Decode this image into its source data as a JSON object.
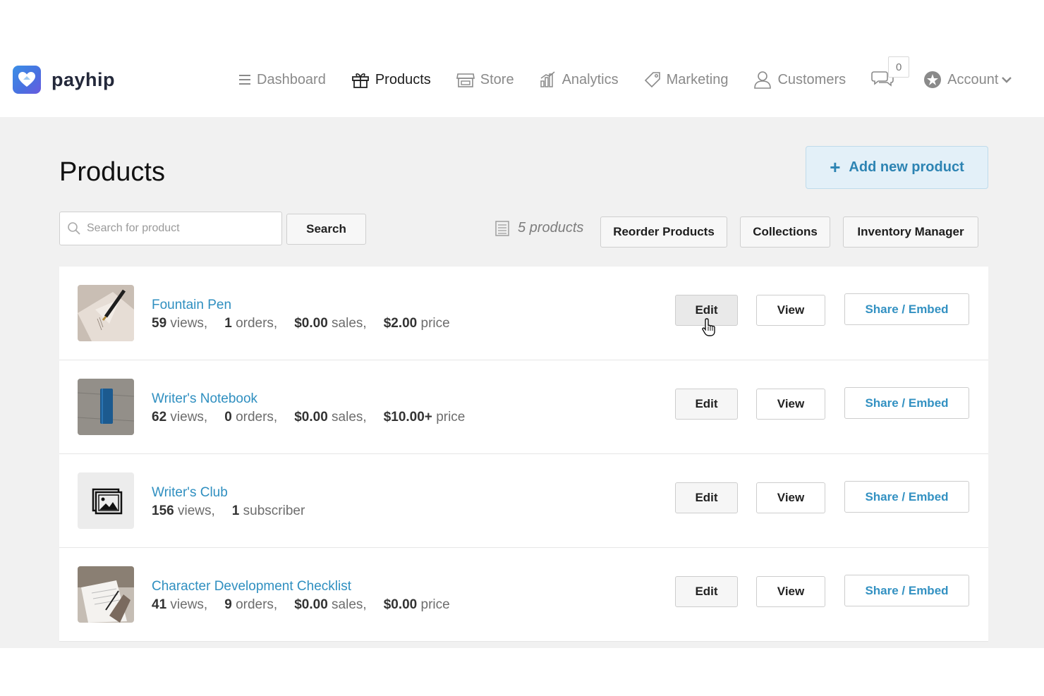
{
  "brand": {
    "name": "payhip"
  },
  "nav": {
    "items": [
      {
        "label": "Dashboard",
        "icon": "hamburger-icon",
        "active": false
      },
      {
        "label": "Products",
        "icon": "gift-icon",
        "active": true
      },
      {
        "label": "Store",
        "icon": "storefront-icon",
        "active": false
      },
      {
        "label": "Analytics",
        "icon": "bar-chart-icon",
        "active": false
      },
      {
        "label": "Marketing",
        "icon": "tag-icon",
        "active": false
      },
      {
        "label": "Customers",
        "icon": "person-icon",
        "active": false
      }
    ],
    "messages_count": "0",
    "account_label": "Account"
  },
  "page": {
    "title": "Products",
    "add_button": "Add new product",
    "search_placeholder": "Search for product",
    "search_button": "Search",
    "count_text": "5 products",
    "reorder_button": "Reorder Products",
    "collections_button": "Collections",
    "inventory_button": "Inventory Manager"
  },
  "buttons": {
    "edit": "Edit",
    "view": "View",
    "share": "Share / Embed"
  },
  "products": [
    {
      "name": "Fountain Pen",
      "views": "59",
      "views_label": "views,",
      "orders": "1",
      "orders_label": "orders,",
      "sales": "$0.00",
      "sales_label": "sales,",
      "price": "$2.00",
      "price_label": "price"
    },
    {
      "name": "Writer's Notebook",
      "views": "62",
      "views_label": "views,",
      "orders": "0",
      "orders_label": "orders,",
      "sales": "$0.00",
      "sales_label": "sales,",
      "price": "$10.00+",
      "price_label": "price"
    },
    {
      "name": "Writer's Club",
      "views": "156",
      "views_label": "views,",
      "subscribers": "1",
      "subscribers_label": "subscriber"
    },
    {
      "name": "Character Development Checklist",
      "views": "41",
      "views_label": "views,",
      "orders": "9",
      "orders_label": "orders,",
      "sales": "$0.00",
      "sales_label": "sales,",
      "price": "$0.00",
      "price_label": "price"
    }
  ]
}
